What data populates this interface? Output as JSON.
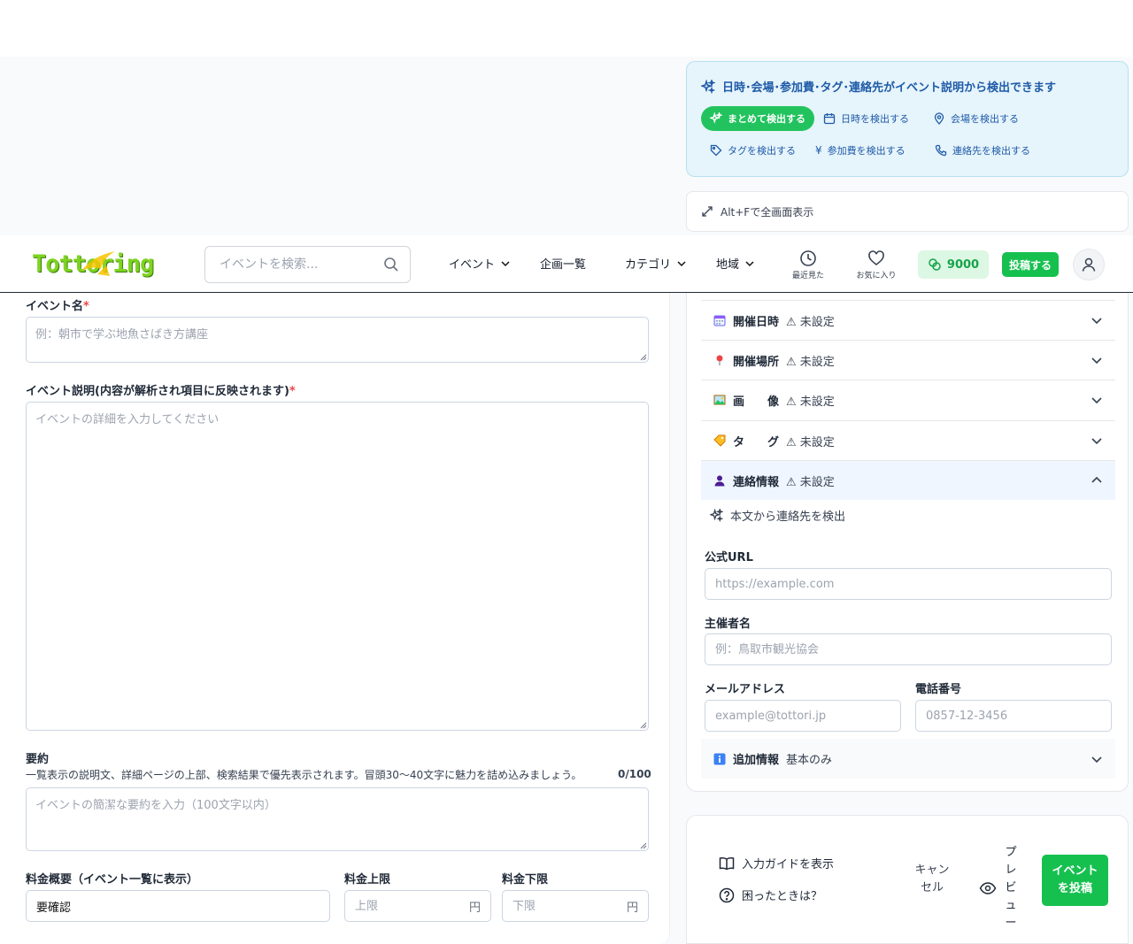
{
  "detect": {
    "title": "日時･会場･参加費･タグ･連絡先がイベント説明から検出できます",
    "all": "まとめて検出する",
    "date": "日時を検出する",
    "venue": "会場を検出する",
    "tag": "タグを検出する",
    "fee": "参加費を検出する",
    "contact": "連絡先を検出する"
  },
  "fullscreen": "Alt+Fで全画面表示",
  "header": {
    "logo": "Tottoring",
    "search_placeholder": "イベントを検索...",
    "nav": [
      "イベント",
      "企画一覧",
      "カテゴリ",
      "地域"
    ],
    "recent": "最近見た",
    "favorites": "お気に入り",
    "points": "9000",
    "post": "投稿する"
  },
  "form": {
    "name_label": "イベント名",
    "required_mark": "*",
    "name_placeholder": "例：朝市で学ぶ地魚さばき方講座",
    "desc_label": "イベント説明(内容が解析され項目に反映されます)",
    "desc_placeholder": "イベントの詳細を入力してください",
    "summary_label": "要約",
    "summary_hint": "一覧表示の説明文、詳細ページの上部、検索結果で優先表示されます。冒頭30〜40文字に魅力を詰め込みましょう。",
    "summary_count": "0/100",
    "summary_placeholder": "イベントの簡潔な要約を入力（100文字以内）",
    "fee_summary_label": "料金概要（イベント一覧に表示）",
    "fee_summary_value": "要確認",
    "fee_max_label": "料金上限",
    "fee_max_placeholder": "上限",
    "fee_min_label": "料金下限",
    "fee_min_placeholder": "下限",
    "yen": "円"
  },
  "sections": {
    "date": {
      "title": "開催日時",
      "status": "⚠ 未設定"
    },
    "place": {
      "title": "開催場所",
      "status": "⚠ 未設定"
    },
    "image": {
      "title": "画　　像",
      "status": "⚠ 未設定"
    },
    "tag": {
      "title": "タ　　グ",
      "status": "⚠ 未設定"
    },
    "contact": {
      "title": "連絡情報",
      "status": "⚠ 未設定"
    },
    "extra": {
      "title": "追加情報",
      "status": "基本のみ"
    }
  },
  "contact": {
    "detect": "本文から連絡先を検出",
    "url_label": "公式URL",
    "url_placeholder": "https://example.com",
    "org_label": "主催者名",
    "org_placeholder": "例：鳥取市観光協会",
    "email_label": "メールアドレス",
    "email_placeholder": "example@tottori.jp",
    "phone_label": "電話番号",
    "phone_placeholder": "0857-12-3456"
  },
  "actions": {
    "guide": "入力ガイドを表示",
    "help": "困ったときは？",
    "cancel": "キャンセル",
    "preview": "プレビュー",
    "submit": "イベントを投稿"
  },
  "colors": {
    "accent": "#16c04f",
    "detect_bg": "#e6f4fb",
    "detect_text": "#1e5aa8",
    "logo": "#7ed321"
  }
}
